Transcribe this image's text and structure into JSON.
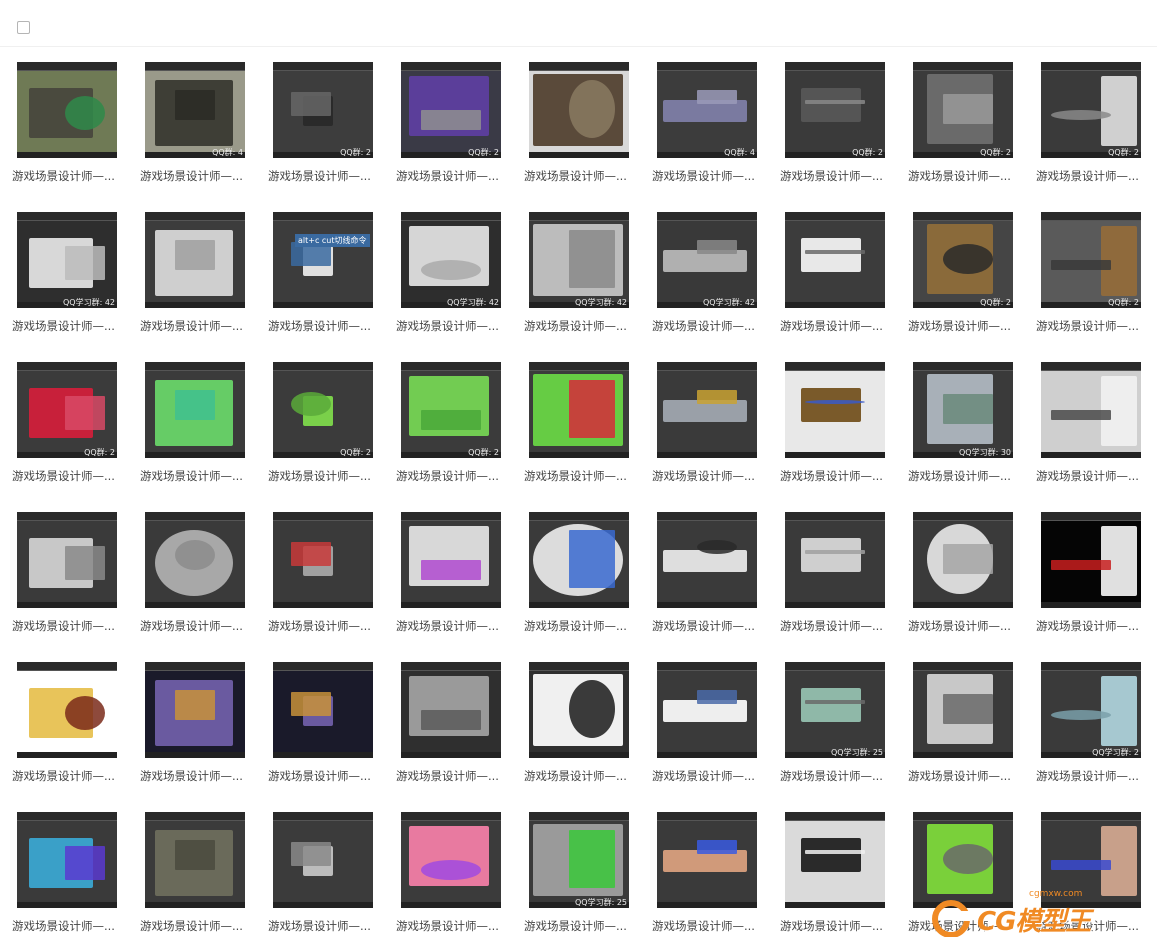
{
  "toolbar": {
    "select_all_icon": "checkbox-icon"
  },
  "tile_caption": "游戏场景设计师—...",
  "tiles": [
    {
      "bg": "#6f7a55",
      "shape": "#4a4a3e",
      "accent": "#2f8a4a",
      "label": ""
    },
    {
      "bg": "#9a9a8a",
      "shape": "#3e3e36",
      "accent": "#2a2a24",
      "label": "QQ群: 4"
    },
    {
      "bg": "#3d3d3d",
      "shape": "#2a2a2a",
      "accent": "#666666",
      "label": "QQ群: 2"
    },
    {
      "bg": "#3a3a46",
      "shape": "#5b3e9a",
      "accent": "#8f8f8f",
      "label": "QQ群: 2"
    },
    {
      "bg": "#d8d8d8",
      "shape": "#5a4a3a",
      "accent": "#8a7a62",
      "label": ""
    },
    {
      "bg": "#3c3c3c",
      "shape": "#7a7aa0",
      "accent": "#9a9ab8",
      "label": "QQ群: 4"
    },
    {
      "bg": "#3a3a3a",
      "shape": "#555555",
      "accent": "#888888",
      "label": "QQ群: 2"
    },
    {
      "bg": "#3b3b3b",
      "shape": "#6a6a6a",
      "accent": "#999999",
      "label": "QQ群: 2"
    },
    {
      "bg": "#3a3a3a",
      "shape": "#d0d0d0",
      "accent": "#8a8a8a",
      "label": "QQ群: 2"
    },
    {
      "bg": "#2e2e2e",
      "shape": "#d8d8d8",
      "accent": "#bcbcbc",
      "label": "QQ学习群: 42"
    },
    {
      "bg": "#3c3c3c",
      "shape": "#cfcfcf",
      "accent": "#a0a0a0",
      "label": ""
    },
    {
      "bg": "#3c3c3c",
      "shape": "#e0e0e0",
      "accent": "#3a6aa0",
      "label": ""
    },
    {
      "bg": "#2d2d2d",
      "shape": "#d6d6d6",
      "accent": "#aaaaaa",
      "label": "QQ学习群: 42"
    },
    {
      "bg": "#3a3a3a",
      "shape": "#bcbcbc",
      "accent": "#8a8a8a",
      "label": "QQ学习群: 42"
    },
    {
      "bg": "#393939",
      "shape": "#b0b0b0",
      "accent": "#888888",
      "label": "QQ学习群: 42"
    },
    {
      "bg": "#3c3c3c",
      "shape": "#e8e8e8",
      "accent": "#6a6a6a",
      "label": ""
    },
    {
      "bg": "#454545",
      "shape": "#8a6a3a",
      "accent": "#2a2a2a",
      "label": "QQ群: 2"
    },
    {
      "bg": "#5a5a5a",
      "shape": "#8f6a3c",
      "accent": "#3a3a3a",
      "label": "QQ群: 2"
    },
    {
      "bg": "#3b3b3b",
      "shape": "#c8203a",
      "accent": "#d84a66",
      "label": "QQ群: 2"
    },
    {
      "bg": "#3b3b3b",
      "shape": "#66cc66",
      "accent": "#3fbf8f",
      "label": ""
    },
    {
      "bg": "#3b3b3b",
      "shape": "#7ad04a",
      "accent": "#5aaa3a",
      "label": "QQ群: 2"
    },
    {
      "bg": "#3b3b3b",
      "shape": "#72cc52",
      "accent": "#4aa83a",
      "label": "QQ群: 2"
    },
    {
      "bg": "#3b3b3b",
      "shape": "#66cc44",
      "accent": "#d62a3a",
      "label": ""
    },
    {
      "bg": "#3a3a3a",
      "shape": "#9aa0a8",
      "accent": "#c9a232",
      "label": ""
    },
    {
      "bg": "#e8e8e8",
      "shape": "#7a5a2a",
      "accent": "#3a5ac8",
      "label": ""
    },
    {
      "bg": "#3a3a3a",
      "shape": "#a8b0b8",
      "accent": "#6a8a7a",
      "label": "QQ学习群: 30"
    },
    {
      "bg": "#cfcfcf",
      "shape": "#eeeeee",
      "accent": "#4a4a4a",
      "label": ""
    },
    {
      "bg": "#3a3a3a",
      "shape": "#c8c8c8",
      "accent": "#8a8a8a",
      "label": ""
    },
    {
      "bg": "#3a3a3a",
      "shape": "#a8a8a8",
      "accent": "#8c8c8c",
      "label": ""
    },
    {
      "bg": "#3a3a3a",
      "shape": "#a0a0a0",
      "accent": "#c83a3a",
      "label": ""
    },
    {
      "bg": "#3a3a3a",
      "shape": "#d8d8d8",
      "accent": "#b04ad0",
      "label": ""
    },
    {
      "bg": "#3a3a3a",
      "shape": "#dcdcdc",
      "accent": "#3a6ad0",
      "label": ""
    },
    {
      "bg": "#3a3a3a",
      "shape": "#dedede",
      "accent": "#2a2a2a",
      "label": ""
    },
    {
      "bg": "#3a3a3a",
      "shape": "#cfcfcf",
      "accent": "#a0a0a0",
      "label": ""
    },
    {
      "bg": "#3a3a3a",
      "shape": "#d8d8d8",
      "accent": "#a6a6a6",
      "label": ""
    },
    {
      "bg": "#050505",
      "shape": "#e0e0e0",
      "accent": "#c81e1e",
      "label": ""
    },
    {
      "bg": "#ffffff",
      "shape": "#e8c45a",
      "accent": "#7a2a1a",
      "label": ""
    },
    {
      "bg": "#1a1a2a",
      "shape": "#6a5aa0",
      "accent": "#c8923a",
      "label": ""
    },
    {
      "bg": "#1a1a2a",
      "shape": "#6a5aa0",
      "accent": "#c8923a",
      "label": ""
    },
    {
      "bg": "#2f2f2f",
      "shape": "#9a9a9a",
      "accent": "#5a5a5a",
      "label": ""
    },
    {
      "bg": "#2f2f2f",
      "shape": "#f0f0f0",
      "accent": "#1a1a1a",
      "label": ""
    },
    {
      "bg": "#3a3a3a",
      "shape": "#eeeeee",
      "accent": "#4a6aa8",
      "label": ""
    },
    {
      "bg": "#3a3a3a",
      "shape": "#8fb8a8",
      "accent": "#6a6a6a",
      "label": "QQ学习群: 25"
    },
    {
      "bg": "#3a3a3a",
      "shape": "#c8c8c8",
      "accent": "#6a6a6a",
      "label": ""
    },
    {
      "bg": "#3a3a3a",
      "shape": "#a6c8d0",
      "accent": "#7aa0aa",
      "label": "QQ学习群: 2"
    },
    {
      "bg": "#3a3a3a",
      "shape": "#3aa0c8",
      "accent": "#5a3ad0",
      "label": ""
    },
    {
      "bg": "#3b3b3b",
      "shape": "#6a6a5a",
      "accent": "#4a4a3e",
      "label": ""
    },
    {
      "bg": "#3b3b3b",
      "shape": "#bcbcbc",
      "accent": "#8a8a8a",
      "label": ""
    },
    {
      "bg": "#3b3b3b",
      "shape": "#e87aa0",
      "accent": "#a04ae0",
      "label": ""
    },
    {
      "bg": "#3a3a3a",
      "shape": "#9a9a9a",
      "accent": "#3ac83a",
      "label": "QQ学习群: 25"
    },
    {
      "bg": "#3a3a3a",
      "shape": "#d09a7a",
      "accent": "#3a5ae0",
      "label": ""
    },
    {
      "bg": "#dadada",
      "shape": "#2a2a2a",
      "accent": "#f0f0f0",
      "label": ""
    },
    {
      "bg": "#3a3a3a",
      "shape": "#7ad03a",
      "accent": "#6a6a6a",
      "label": ""
    },
    {
      "bg": "#3a3a3a",
      "shape": "#c8a08a",
      "accent": "#3a4ad0",
      "label": ""
    }
  ],
  "thumb_overlays": {
    "tile_12_text": "alt+c   cut切线命令"
  },
  "watermark": {
    "brand": "CG模型王",
    "url": "cgmxw.com"
  }
}
